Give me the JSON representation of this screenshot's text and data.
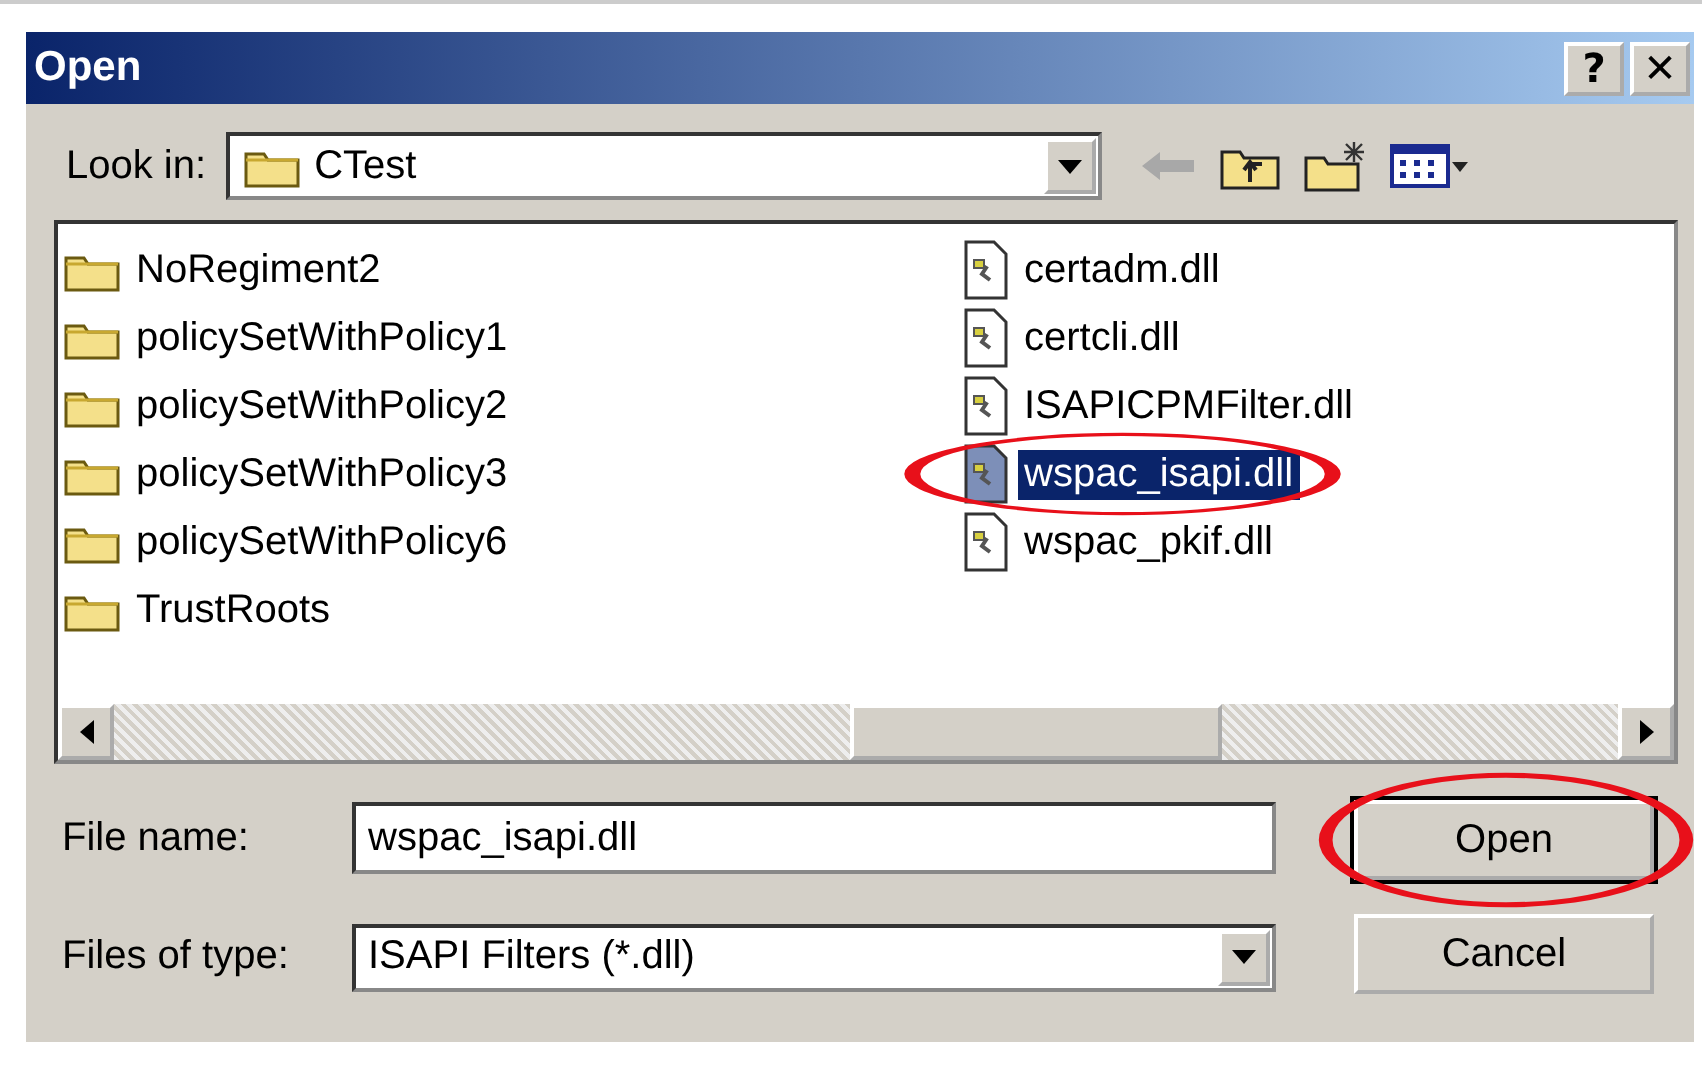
{
  "window": {
    "title": "Open",
    "help_button": "?",
    "close_button": "✕"
  },
  "look_in": {
    "label": "Look in:",
    "location": "CTest"
  },
  "files": [
    {
      "name": "NoRegiment2",
      "kind": "folder",
      "selected": false,
      "circled": false
    },
    {
      "name": "policySetWithPolicy1",
      "kind": "folder",
      "selected": false,
      "circled": false
    },
    {
      "name": "policySetWithPolicy2",
      "kind": "folder",
      "selected": false,
      "circled": false
    },
    {
      "name": "policySetWithPolicy3",
      "kind": "folder",
      "selected": false,
      "circled": false
    },
    {
      "name": "policySetWithPolicy6",
      "kind": "folder",
      "selected": false,
      "circled": false
    },
    {
      "name": "TrustRoots",
      "kind": "folder",
      "selected": false,
      "circled": false
    },
    {
      "name": "certadm.dll",
      "kind": "file",
      "selected": false,
      "circled": false
    },
    {
      "name": "certcli.dll",
      "kind": "file",
      "selected": false,
      "circled": false
    },
    {
      "name": "ISAPICPMFilter.dll",
      "kind": "file",
      "selected": false,
      "circled": false
    },
    {
      "name": "wspac_isapi.dll",
      "kind": "file",
      "selected": true,
      "circled": true
    },
    {
      "name": "wspac_pkif.dll",
      "kind": "file",
      "selected": false,
      "circled": false
    }
  ],
  "file_name": {
    "label": "File name:",
    "value": "wspac_isapi.dll"
  },
  "files_of_type": {
    "label": "Files of type:",
    "value": "ISAPI Filters (*.dll)"
  },
  "buttons": [
    {
      "label": "Open",
      "default": true,
      "circled": true
    },
    {
      "label": "Cancel",
      "default": false,
      "circled": false
    }
  ]
}
